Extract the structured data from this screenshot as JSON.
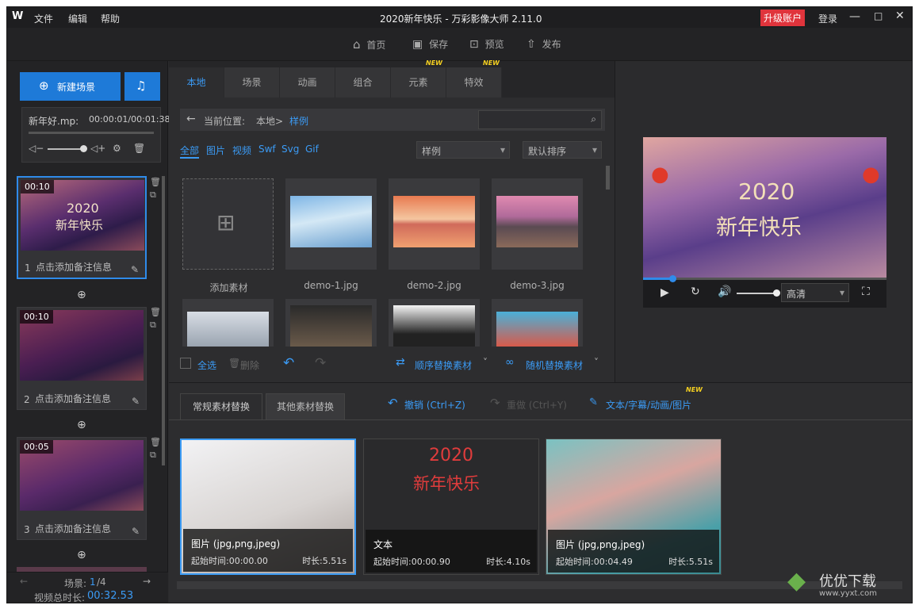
{
  "app": {
    "logo": "W",
    "menu": [
      "文件",
      "编辑",
      "帮助"
    ],
    "title": "2020新年快乐 - 万彩影像大师 2.11.0",
    "upgrade": "升级账户",
    "login": "登录"
  },
  "toolbar": {
    "home": "首页",
    "save": "保存",
    "preview": "预览",
    "publish": "发布"
  },
  "left": {
    "new_scene": "新建场景",
    "audio_name": "新年好.mp:",
    "audio_time": "00:00:01/00:01:38",
    "scenes": [
      {
        "duration": "00:10",
        "index": "1",
        "note": "点击添加备注信息",
        "overlay1": "2020",
        "overlay2": "新年快乐"
      },
      {
        "duration": "00:10",
        "index": "2",
        "note": "点击添加备注信息"
      },
      {
        "duration": "00:05",
        "index": "3",
        "note": "点击添加备注信息"
      }
    ],
    "scene_label": "场景:",
    "scene_current": "1",
    "scene_total": "/4",
    "total_label": "视频总时长:",
    "total_value": "00:32.53"
  },
  "library": {
    "tabs": [
      "本地",
      "场景",
      "动画",
      "组合",
      "元素",
      "特效"
    ],
    "new_badge": "NEW",
    "location_label": "当前位置:",
    "location_path": "本地>",
    "location_current": "样例",
    "filters": [
      "全部",
      "图片",
      "视频",
      "Swf",
      "Svg",
      "Gif"
    ],
    "folder_select": "样例",
    "sort_select": "默认排序",
    "add_label": "添加素材",
    "items": [
      "demo-1.jpg",
      "demo-2.jpg",
      "demo-3.jpg"
    ],
    "select_all": "全选",
    "delete": "删除",
    "seq_replace": "顺序替换素材",
    "rand_replace": "随机替换素材"
  },
  "preview": {
    "overlay_year": "2020",
    "overlay_text": "新年快乐",
    "quality": "高清",
    "progress": 0.12
  },
  "bottom": {
    "tabs": [
      "常规素材替换",
      "其他素材替换"
    ],
    "undo": "撤销 (Ctrl+Z)",
    "redo": "重做 (Ctrl+Y)",
    "text_edit": "文本/字幕/动画/图片",
    "new_badge": "NEW",
    "cards": [
      {
        "kind": "图片 (jpg,png,jpeg)",
        "start": "起始时间:00:00.00",
        "dur": "时长:5.51s"
      },
      {
        "kind": "文本",
        "start": "起始时间:00:00.90",
        "dur": "时长:4.10s",
        "line1": "2020",
        "line2": "新年快乐"
      },
      {
        "kind": "图片 (jpg,png,jpeg)",
        "start": "起始时间:00:04.49",
        "dur": "时长:5.51s"
      }
    ]
  },
  "watermark": {
    "brand": "优优下载",
    "url": "www.yyxt.com"
  }
}
